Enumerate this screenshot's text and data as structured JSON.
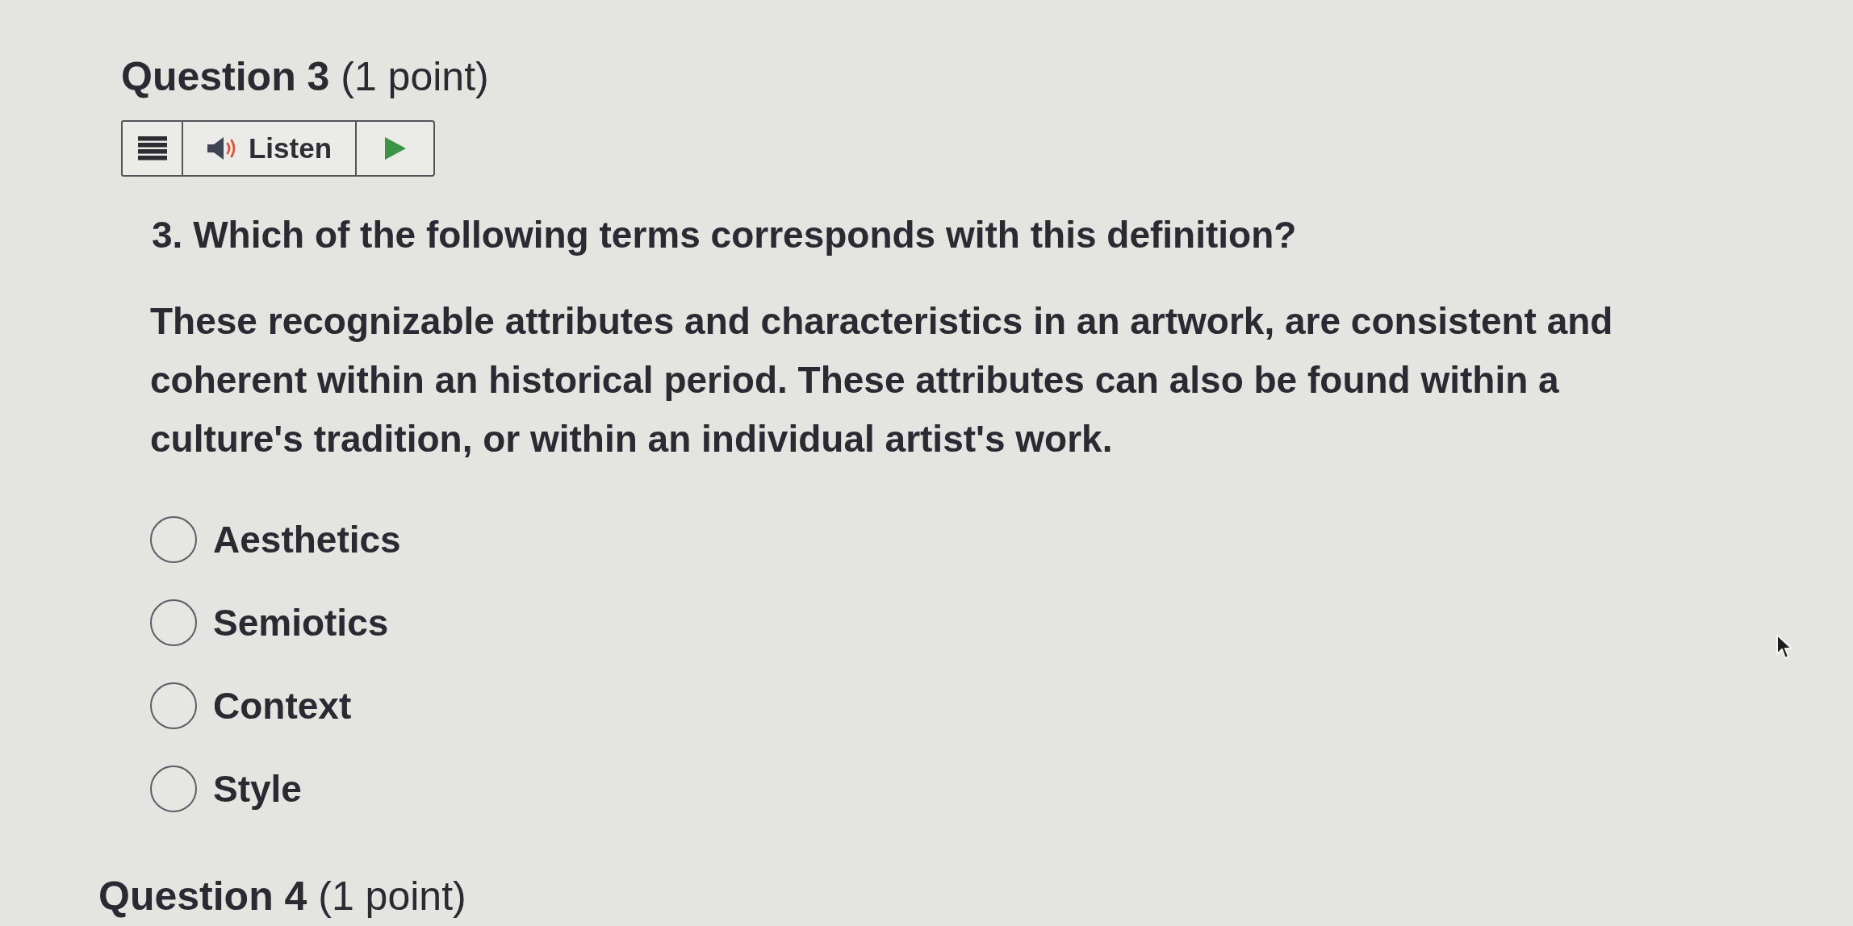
{
  "question": {
    "heading": "**Question 3** (1 point)",
    "toolbar": {
      "listen_label": "Listen"
    },
    "prompt": "3. Which of the following terms corresponds with this definition?",
    "definition": "These recognizable attributes and characteristics in an artwork, are consistent and coherent within an historical period. These attributes can also be found within a culture's tradition, or within an individual artist's work.",
    "options": [
      {
        "label": "Aesthetics",
        "selected": false
      },
      {
        "label": "Semiotics",
        "selected": false
      },
      {
        "label": "Context",
        "selected": false
      },
      {
        "label": "Style",
        "selected": false
      }
    ]
  },
  "next_question": {
    "heading": "**Question 4** (1 point)"
  }
}
